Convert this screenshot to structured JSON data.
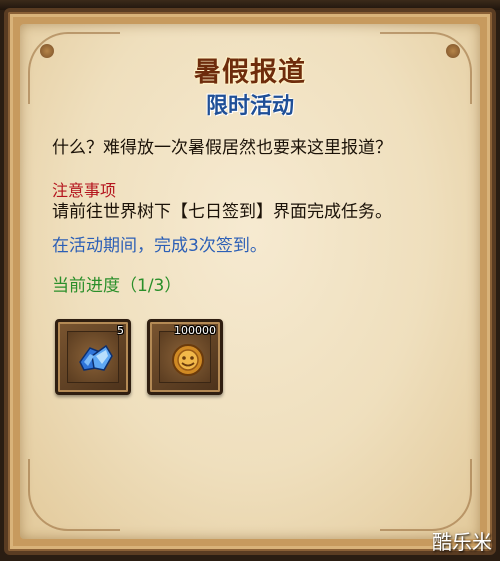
{
  "header": {
    "title": "暑假报道",
    "subtitle": "限时活动"
  },
  "content": {
    "question": "什么？难得放一次暑假居然也要来这里报道？",
    "notice_label": "注意事项",
    "notice_body": "请前往世界树下【七日签到】界面完成任务。",
    "activity_requirement": "在活动期间，完成3次签到。",
    "progress": "当前进度（1/3）"
  },
  "rewards": [
    {
      "icon": "blue-crystal-icon",
      "count": "5"
    },
    {
      "icon": "gold-coin-icon",
      "count": "100000"
    }
  ],
  "watermark": "酷乐米",
  "colors": {
    "title": "#6e2c0c",
    "subtitle": "#1f4f97",
    "notice": "#b4141d",
    "activity": "#2c5fb6",
    "progress": "#2a8f2a"
  }
}
